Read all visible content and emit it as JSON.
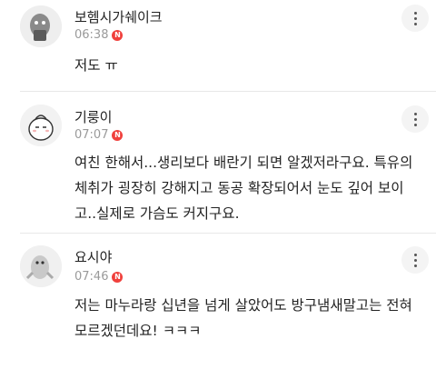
{
  "comments": [
    {
      "author": "보헴시가쉐이크",
      "time": "06:38",
      "badge": "N",
      "text": "저도 ㅠ"
    },
    {
      "author": "기룽이",
      "time": "07:07",
      "badge": "N",
      "text": "여친 한해서...생리보다 배란기 되면 알겠저라구요. 특유의 체취가 굉장히 강해지고 동공 확장되어서 눈도 깊어 보이고..실제로 가슴도 커지구요."
    },
    {
      "author": "요시야",
      "time": "07:46",
      "badge": "N",
      "text": "저는 마누라랑 십년을 넘게 살았어도 방구냄새말고는 전혀 모르겠던데요! ㅋㅋㅋ"
    }
  ],
  "icons": {
    "more": "more-vertical-icon",
    "new": "new-badge-icon"
  },
  "colors": {
    "badge": "#f0403c",
    "time": "#9a9a9a"
  }
}
